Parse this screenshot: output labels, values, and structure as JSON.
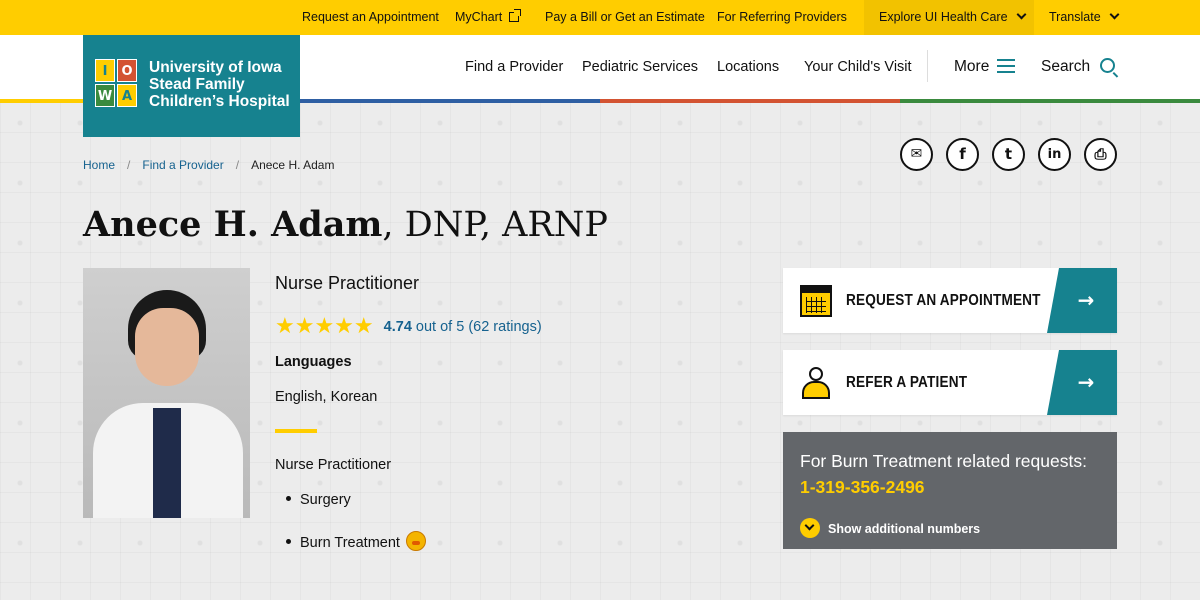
{
  "utility": {
    "links": [
      {
        "label": "Request an Appointment"
      },
      {
        "label": "MyChart"
      },
      {
        "label": "Pay a Bill or Get an Estimate"
      },
      {
        "label": "For Referring Providers"
      }
    ],
    "explore": "Explore UI Health Care",
    "translate": "Translate"
  },
  "logo": {
    "line1": "University of Iowa",
    "line2": "Stead Family",
    "line3": "Children’s Hospital",
    "tiles": [
      "I",
      "O",
      "W",
      "A"
    ]
  },
  "nav": {
    "items": [
      "Find a Provider",
      "Pediatric Services",
      "Locations",
      "Your Child's Visit"
    ],
    "more": "More",
    "search": "Search"
  },
  "breadcrumb": {
    "home": "Home",
    "find": "Find a Provider",
    "current": "Anece H. Adam"
  },
  "share": {
    "email": "✉",
    "facebook": "f",
    "twitter": "t",
    "linkedin": "in",
    "print": "⎙"
  },
  "provider": {
    "name": "Anece H. Adam",
    "credentials": ", DNP, ARNP",
    "title": "Nurse Practitioner",
    "stars": "★★★★★",
    "score": "4.74",
    "out_of": "out of 5 (62 ratings)",
    "languages_heading": "Languages",
    "languages": "English, Korean",
    "specialty_heading": "Nurse Practitioner",
    "specialties": [
      "Surgery",
      "Burn Treatment"
    ]
  },
  "actions": {
    "request_label": "REQUEST AN APPOINTMENT",
    "refer_label": "REFER A PATIENT",
    "arrow": "→"
  },
  "phone": {
    "heading": "For Burn Treatment related requests:",
    "number": "1-319-356-2496",
    "more": "Show additional numbers"
  },
  "colors": {
    "brand_yellow": "#ffcd00",
    "brand_teal": "#16828f",
    "stripe": [
      "#ffcd00",
      "#2e5fa3",
      "#d35332",
      "#3a8a3e"
    ]
  }
}
